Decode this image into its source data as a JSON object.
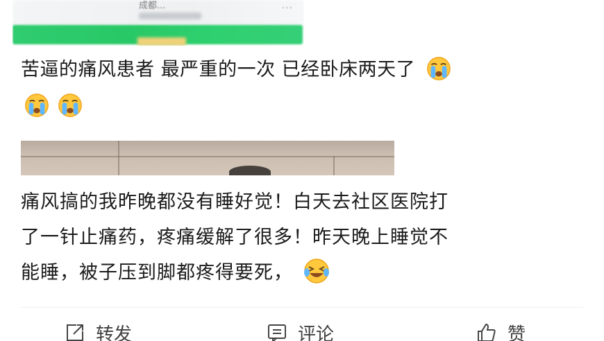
{
  "header": {
    "account_name": "成都...",
    "more_icon": "more-dots-icon"
  },
  "post": {
    "text": "苦逼的痛风患者 最严重的一次 已经卧床两天了",
    "emoji": "crying-face-icon"
  },
  "comment": {
    "line1": "痛风搞的我昨晚都没有睡好觉！白天去社区医院打",
    "line2": "了一针止痛药，疼痛缓解了很多！昨天晚上睡觉不",
    "line3": "能睡，被子压到脚都疼得要死，",
    "emoji": "laughing-tears-icon"
  },
  "actions": {
    "repost_label": "转发",
    "comment_label": "评论",
    "like_label": "赞"
  }
}
